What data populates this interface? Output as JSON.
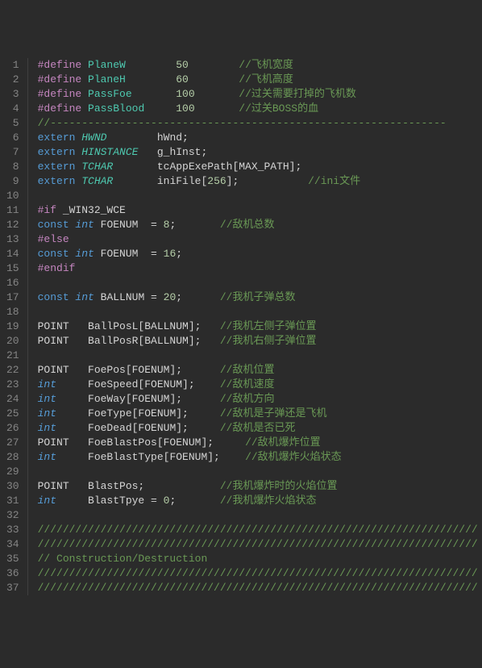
{
  "lines": [
    {
      "n": 1,
      "tokens": [
        {
          "t": "#define ",
          "c": "kw-define"
        },
        {
          "t": "PlaneW        ",
          "c": "ident-macro"
        },
        {
          "t": "50        ",
          "c": "num"
        },
        {
          "t": "//飞机宽度",
          "c": "comment"
        }
      ]
    },
    {
      "n": 2,
      "tokens": [
        {
          "t": "#define ",
          "c": "kw-define"
        },
        {
          "t": "PlaneH        ",
          "c": "ident-macro"
        },
        {
          "t": "60        ",
          "c": "num"
        },
        {
          "t": "//飞机高度",
          "c": "comment"
        }
      ]
    },
    {
      "n": 3,
      "tokens": [
        {
          "t": "#define ",
          "c": "kw-define"
        },
        {
          "t": "PassFoe       ",
          "c": "ident-macro"
        },
        {
          "t": "100       ",
          "c": "num"
        },
        {
          "t": "//过关需要打掉的飞机数",
          "c": "comment"
        }
      ]
    },
    {
      "n": 4,
      "tokens": [
        {
          "t": "#define ",
          "c": "kw-define"
        },
        {
          "t": "PassBlood     ",
          "c": "ident-macro"
        },
        {
          "t": "100       ",
          "c": "num"
        },
        {
          "t": "//过关BOSS的血",
          "c": "comment"
        }
      ]
    },
    {
      "n": 5,
      "tokens": [
        {
          "t": "//---------------------------------------------------------------",
          "c": "comment"
        }
      ]
    },
    {
      "n": 6,
      "tokens": [
        {
          "t": "extern ",
          "c": "kw-extern"
        },
        {
          "t": "HWND        ",
          "c": "ident-type"
        },
        {
          "t": "hWnd;",
          "c": "plain"
        }
      ]
    },
    {
      "n": 7,
      "tokens": [
        {
          "t": "extern ",
          "c": "kw-extern"
        },
        {
          "t": "HINSTANCE   ",
          "c": "ident-type"
        },
        {
          "t": "g_hInst;",
          "c": "plain"
        }
      ]
    },
    {
      "n": 8,
      "tokens": [
        {
          "t": "extern ",
          "c": "kw-extern"
        },
        {
          "t": "TCHAR       ",
          "c": "ident-type"
        },
        {
          "t": "tcAppExePath[MAX_PATH];",
          "c": "plain"
        }
      ]
    },
    {
      "n": 9,
      "tokens": [
        {
          "t": "extern ",
          "c": "kw-extern"
        },
        {
          "t": "TCHAR       ",
          "c": "ident-type"
        },
        {
          "t": "iniFile[",
          "c": "plain"
        },
        {
          "t": "256",
          "c": "num"
        },
        {
          "t": "];           ",
          "c": "plain"
        },
        {
          "t": "//ini文件",
          "c": "comment"
        }
      ]
    },
    {
      "n": 10,
      "tokens": []
    },
    {
      "n": 11,
      "tokens": [
        {
          "t": "#if ",
          "c": "kw-preproc"
        },
        {
          "t": "_WIN32_WCE",
          "c": "plain"
        }
      ]
    },
    {
      "n": 12,
      "tokens": [
        {
          "t": "const ",
          "c": "kw-const"
        },
        {
          "t": "int ",
          "c": "ident-builtin"
        },
        {
          "t": "FOENUM  = ",
          "c": "plain"
        },
        {
          "t": "8",
          "c": "num"
        },
        {
          "t": ";       ",
          "c": "plain"
        },
        {
          "t": "//敌机总数",
          "c": "comment"
        }
      ]
    },
    {
      "n": 13,
      "tokens": [
        {
          "t": "#else",
          "c": "kw-preproc"
        }
      ]
    },
    {
      "n": 14,
      "tokens": [
        {
          "t": "const ",
          "c": "kw-const"
        },
        {
          "t": "int ",
          "c": "ident-builtin"
        },
        {
          "t": "FOENUM  = ",
          "c": "plain"
        },
        {
          "t": "16",
          "c": "num"
        },
        {
          "t": ";",
          "c": "plain"
        }
      ]
    },
    {
      "n": 15,
      "tokens": [
        {
          "t": "#endif",
          "c": "kw-preproc"
        }
      ]
    },
    {
      "n": 16,
      "tokens": []
    },
    {
      "n": 17,
      "tokens": [
        {
          "t": "const ",
          "c": "kw-const"
        },
        {
          "t": "int ",
          "c": "ident-builtin"
        },
        {
          "t": "BALLNUM = ",
          "c": "plain"
        },
        {
          "t": "20",
          "c": "num"
        },
        {
          "t": ";      ",
          "c": "plain"
        },
        {
          "t": "//我机子弹总数",
          "c": "comment"
        }
      ]
    },
    {
      "n": 18,
      "tokens": []
    },
    {
      "n": 19,
      "tokens": [
        {
          "t": "POINT   BallPosL[BALLNUM];   ",
          "c": "plain"
        },
        {
          "t": "//我机左侧子弹位置",
          "c": "comment"
        }
      ]
    },
    {
      "n": 20,
      "tokens": [
        {
          "t": "POINT   BallPosR[BALLNUM];   ",
          "c": "plain"
        },
        {
          "t": "//我机右侧子弹位置",
          "c": "comment"
        }
      ]
    },
    {
      "n": 21,
      "tokens": []
    },
    {
      "n": 22,
      "tokens": [
        {
          "t": "POINT   FoePos[FOENUM];      ",
          "c": "plain"
        },
        {
          "t": "//敌机位置",
          "c": "comment"
        }
      ]
    },
    {
      "n": 23,
      "tokens": [
        {
          "t": "int",
          "c": "ident-builtin"
        },
        {
          "t": "     FoeSpeed[FOENUM];    ",
          "c": "plain"
        },
        {
          "t": "//敌机速度",
          "c": "comment"
        }
      ]
    },
    {
      "n": 24,
      "tokens": [
        {
          "t": "int",
          "c": "ident-builtin"
        },
        {
          "t": "     FoeWay[FOENUM];      ",
          "c": "plain"
        },
        {
          "t": "//敌机方向",
          "c": "comment"
        }
      ]
    },
    {
      "n": 25,
      "tokens": [
        {
          "t": "int",
          "c": "ident-builtin"
        },
        {
          "t": "     FoeType[FOENUM];     ",
          "c": "plain"
        },
        {
          "t": "//敌机是子弹还是飞机",
          "c": "comment"
        }
      ]
    },
    {
      "n": 26,
      "tokens": [
        {
          "t": "int",
          "c": "ident-builtin"
        },
        {
          "t": "     FoeDead[FOENUM];     ",
          "c": "plain"
        },
        {
          "t": "//敌机是否已死",
          "c": "comment"
        }
      ]
    },
    {
      "n": 27,
      "tokens": [
        {
          "t": "POINT   FoeBlastPos[FOENUM];     ",
          "c": "plain"
        },
        {
          "t": "//敌机爆炸位置",
          "c": "comment"
        }
      ]
    },
    {
      "n": 28,
      "tokens": [
        {
          "t": "int",
          "c": "ident-builtin"
        },
        {
          "t": "     FoeBlastType[FOENUM];    ",
          "c": "plain"
        },
        {
          "t": "//敌机爆炸火焰状态",
          "c": "comment"
        }
      ]
    },
    {
      "n": 29,
      "tokens": []
    },
    {
      "n": 30,
      "tokens": [
        {
          "t": "POINT   BlastPos;            ",
          "c": "plain"
        },
        {
          "t": "//我机爆炸时的火焰位置",
          "c": "comment"
        }
      ]
    },
    {
      "n": 31,
      "tokens": [
        {
          "t": "int",
          "c": "ident-builtin"
        },
        {
          "t": "     BlastTpye = ",
          "c": "plain"
        },
        {
          "t": "0",
          "c": "num"
        },
        {
          "t": ";       ",
          "c": "plain"
        },
        {
          "t": "//我机爆炸火焰状态",
          "c": "comment"
        }
      ]
    },
    {
      "n": 32,
      "tokens": []
    },
    {
      "n": 33,
      "tokens": [
        {
          "t": "//////////////////////////////////////////////////////////////////////",
          "c": "comment"
        }
      ]
    },
    {
      "n": 34,
      "tokens": [
        {
          "t": "//////////////////////////////////////////////////////////////////////",
          "c": "comment"
        }
      ]
    },
    {
      "n": 35,
      "tokens": [
        {
          "t": "// Construction/Destruction",
          "c": "comment"
        }
      ]
    },
    {
      "n": 36,
      "tokens": [
        {
          "t": "//////////////////////////////////////////////////////////////////////",
          "c": "comment"
        }
      ]
    },
    {
      "n": 37,
      "tokens": [
        {
          "t": "//////////////////////////////////////////////////////////////////////",
          "c": "comment"
        }
      ]
    }
  ]
}
